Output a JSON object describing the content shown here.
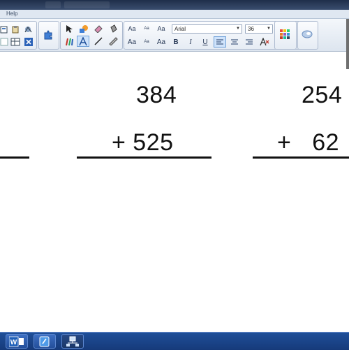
{
  "menu": {
    "help": "Help"
  },
  "toolbar": {
    "font_name": "Arial",
    "font_size": "36",
    "style_labels": {
      "aa_big": "Aa",
      "aa_small": "Aa",
      "aa_mixed": "Aa",
      "aa_big2": "Aa",
      "aa_small2": "Aa",
      "aa_mixed2": "Aa",
      "bold": "B",
      "italic": "I",
      "underline": "U"
    }
  },
  "canvas": {
    "problem1": {
      "top": "384",
      "bottom": "+ 525"
    },
    "problem2": {
      "top": "254",
      "bottom": "+   62"
    }
  },
  "taskbar": {
    "items": [
      {
        "icon": "word-icon",
        "label": "W"
      },
      {
        "icon": "notebook-icon"
      },
      {
        "icon": "network-icon"
      }
    ]
  },
  "colors": {
    "toolbar_bg": "#e6ecf4",
    "taskbar": "#1f4f99",
    "selected_tool": "#cfe3fb"
  }
}
